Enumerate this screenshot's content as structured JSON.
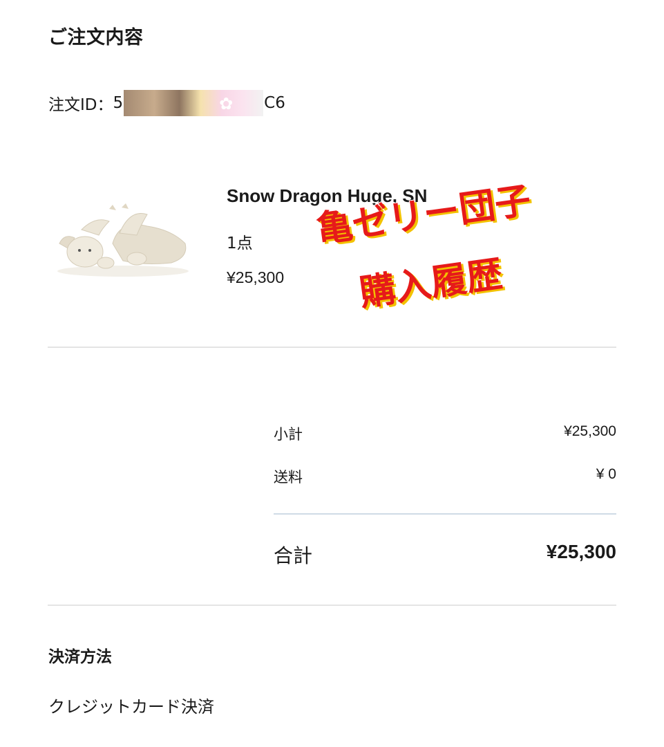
{
  "order": {
    "section_title": "ご注文内容",
    "id_label": "注文ID：",
    "id_prefix": "5",
    "id_suffix": "C6"
  },
  "product": {
    "name": "Snow Dragon Huge, SN",
    "quantity": "1点",
    "price": "¥25,300",
    "image_icon": "plush-dragon-image"
  },
  "overlay": {
    "line1": "亀ゼリー団子",
    "line2": "購入履歴",
    "color": "#e61a1a",
    "shadow_color": "#f3c200"
  },
  "totals": {
    "subtotal_label": "小計",
    "subtotal_value": "¥25,300",
    "shipping_label": "送料",
    "shipping_value": "¥ 0",
    "total_label": "合計",
    "total_value": "¥25,300"
  },
  "payment": {
    "title": "決済方法",
    "method": "クレジットカード決済"
  }
}
